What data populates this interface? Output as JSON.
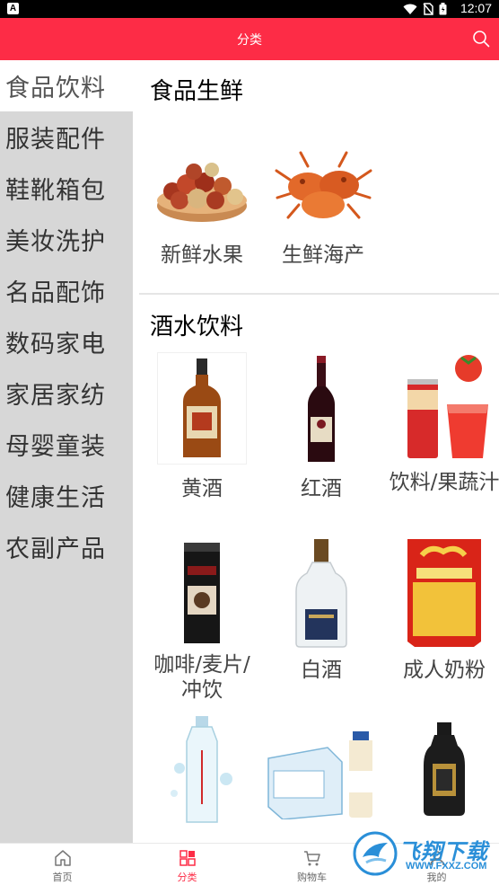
{
  "status_bar": {
    "badge": "A",
    "time": "12:07"
  },
  "header": {
    "title": "分类"
  },
  "sidebar": {
    "items": [
      {
        "label": "食品饮料",
        "active": true
      },
      {
        "label": "服装配件"
      },
      {
        "label": "鞋靴箱包"
      },
      {
        "label": "美妆洗护"
      },
      {
        "label": "名品配饰"
      },
      {
        "label": "数码家电"
      },
      {
        "label": "家居家纺"
      },
      {
        "label": "母婴童装"
      },
      {
        "label": "健康生活"
      },
      {
        "label": "农副产品"
      }
    ]
  },
  "main": {
    "sections": [
      {
        "title": "食品生鲜",
        "items": [
          {
            "label": "新鲜水果",
            "icon": "fruit-icon"
          },
          {
            "label": "生鲜海产",
            "icon": "crab-icon"
          }
        ]
      },
      {
        "title": "酒水饮料",
        "items": [
          {
            "label": "黄酒",
            "icon": "yellow-wine-icon"
          },
          {
            "label": "红酒",
            "icon": "red-wine-icon"
          },
          {
            "label": "饮料/果蔬汁",
            "icon": "juice-icon"
          },
          {
            "label": "咖啡/麦片/冲饮",
            "icon": "coffee-icon"
          },
          {
            "label": "白酒",
            "icon": "baijiu-icon"
          },
          {
            "label": "成人奶粉",
            "icon": "milk-powder-icon"
          },
          {
            "label": "",
            "icon": "water-bottle-icon"
          },
          {
            "label": "",
            "icon": "milk-box-icon"
          },
          {
            "label": "",
            "icon": "liquor-bottle-icon"
          }
        ]
      }
    ]
  },
  "bottom_nav": {
    "items": [
      {
        "label": "首页",
        "icon": "home-icon"
      },
      {
        "label": "分类",
        "icon": "category-icon",
        "active": true
      },
      {
        "label": "购物车",
        "icon": "cart-icon"
      },
      {
        "label": "我的",
        "icon": "user-icon"
      }
    ]
  },
  "watermark": {
    "title": "飞翔下载",
    "url": "WWW.FXXZ.COM"
  },
  "colors": {
    "accent": "#fd2c46",
    "sidebar_bg": "#d7d7d7"
  }
}
